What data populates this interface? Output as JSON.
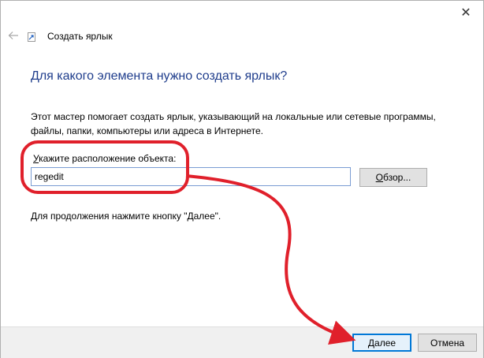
{
  "window": {
    "close_glyph": "✕",
    "title": "Создать ярлык"
  },
  "wizard": {
    "heading": "Для какого элемента нужно создать ярлык?",
    "description": "Этот мастер помогает создать ярлык, указывающий на локальные или сетевые программы, файлы, папки, компьютеры или адреса в Интернете.",
    "field_label_accel": "У",
    "field_label_rest": "кажите расположение объекта:",
    "location_value": "regedit",
    "browse_accel": "О",
    "browse_rest": "бзор...",
    "hint": "Для продолжения нажмите кнопку \"Далее\"."
  },
  "footer": {
    "next_accel": "Д",
    "next_rest": "алее",
    "cancel_label": "Отмена"
  },
  "annotation": {
    "color": "#e0202b"
  }
}
